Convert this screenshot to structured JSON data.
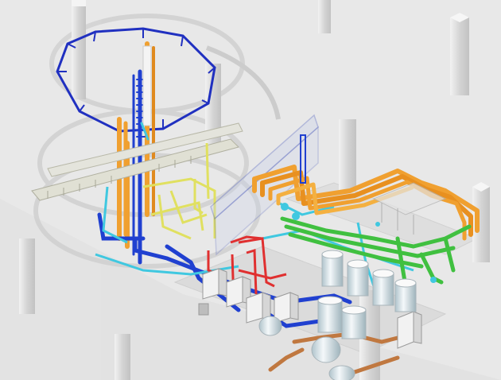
{
  "scene": {
    "type": "isometric-bim-model",
    "background_color": "#e8e8e8",
    "description_visible_text": "",
    "colors": {
      "orange_pipe": "#f0a030",
      "blue_pipe": "#2040d0",
      "cyan_pipe": "#40c8e0",
      "yellow_pipe": "#e0e060",
      "green_pipe": "#40c040",
      "red_pipe": "#e03030",
      "brown_pipe": "#c07840",
      "column": "#dcdcdc",
      "tank": "#eef2f6",
      "ring_frame": "#2030c0"
    }
  }
}
